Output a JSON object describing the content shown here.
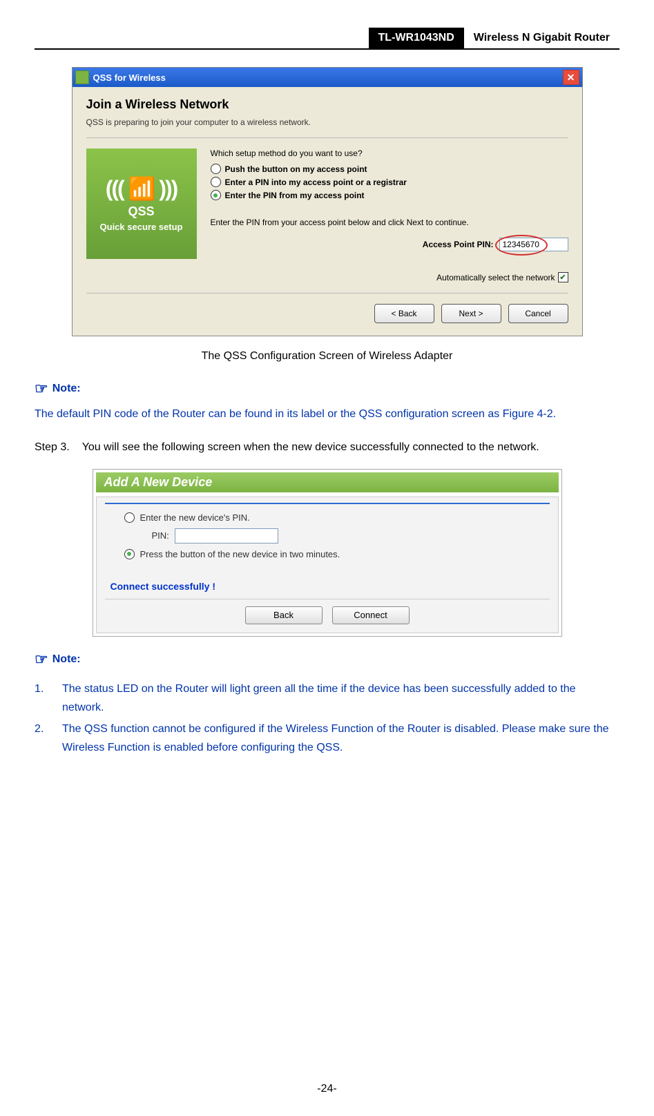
{
  "header": {
    "model": "TL-WR1043ND",
    "product": "Wireless N Gigabit Router"
  },
  "dialog1": {
    "title": "QSS for Wireless",
    "heading": "Join a Wireless Network",
    "subtext": "QSS is preparing to join your computer to a wireless network.",
    "qss_big": "QSS",
    "qss_sub": "Quick secure setup",
    "question": "Which setup method do you want to use?",
    "option1": "Push the button on my access point",
    "option2": "Enter a PIN into my access point or a registrar",
    "option3": "Enter the PIN from my access point",
    "pin_instruction": "Enter the PIN from your access point below and click Next to continue.",
    "pin_label": "Access Point PIN:",
    "pin_value": "12345670",
    "auto_label": "Automatically select the network",
    "back": "< Back",
    "next": "Next >",
    "cancel": "Cancel"
  },
  "caption1": "The QSS Configuration Screen of Wireless Adapter",
  "note_label": "Note:",
  "note1_text": "The default PIN code of the Router can be found in its label or the QSS configuration screen as Figure 4-2.",
  "step3": {
    "num": "Step 3.",
    "text": "You will see the following screen when the new device successfully connected to the network."
  },
  "dialog2": {
    "title": "Add A New Device",
    "option1": "Enter the new device's PIN.",
    "pin_label": "PIN:",
    "option2": "Press the button of the new device in two minutes.",
    "success": "Connect successfully !",
    "back": "Back",
    "connect": "Connect"
  },
  "note2_items": [
    {
      "num": "1.",
      "text": "The status LED on the Router will light green all the time if the device has been successfully added to the network."
    },
    {
      "num": "2.",
      "text": "The QSS function cannot be configured if the Wireless Function of the Router is disabled. Please make sure the Wireless Function is enabled before configuring the QSS."
    }
  ],
  "page_num": "-24-"
}
